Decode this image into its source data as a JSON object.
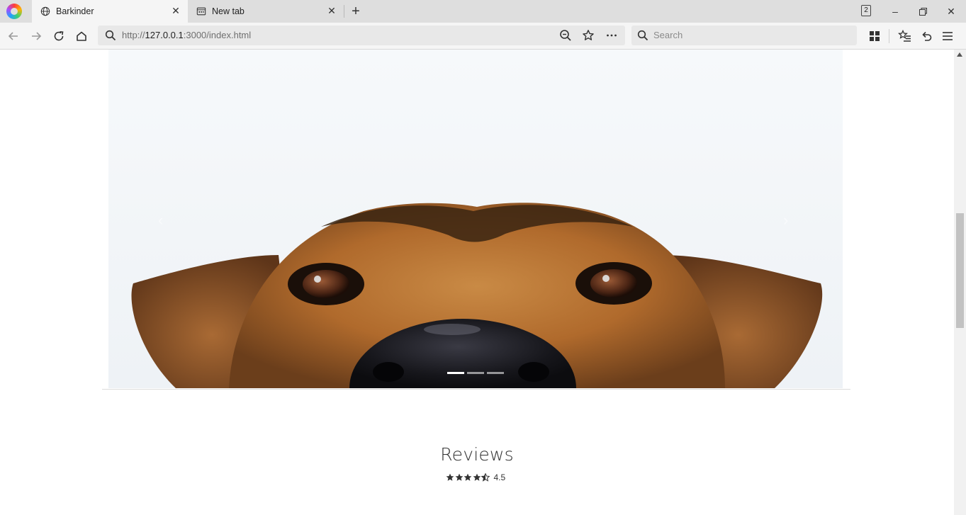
{
  "tabs": [
    {
      "title": "Barkinder",
      "icon": "globe-icon",
      "active": true
    },
    {
      "title": "New tab",
      "icon": "newtab-page-icon",
      "active": false
    }
  ],
  "window": {
    "tab_count": "2"
  },
  "toolbar": {
    "url_prefix": "http://",
    "url_host": "127.0.0.1",
    "url_rest": ":3000/index.html",
    "search_placeholder": "Search"
  },
  "page": {
    "reviews_title": "Reviews",
    "rating_value": "4.5",
    "rating_stars": 4.5,
    "rating_max": 5,
    "carousel": {
      "slides": 3,
      "active_index": 0
    }
  },
  "colors": {
    "chrome_bg": "#dedede",
    "toolbar_bg": "#f5f5f5",
    "text": "#333333"
  }
}
